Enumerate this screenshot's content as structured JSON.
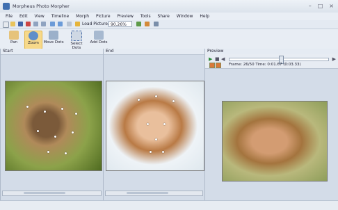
{
  "window": {
    "title": "Morpheus Photo Morpher",
    "controls": [
      "–",
      "□",
      "×"
    ]
  },
  "menu": [
    "File",
    "Edit",
    "View",
    "Timeline",
    "Morph",
    "Picture",
    "Preview",
    "Tools",
    "Share",
    "Window",
    "Help"
  ],
  "toolbar1": {
    "load_label": "Load Picture...",
    "zoom_value": "90.26%"
  },
  "tools": [
    {
      "label": "Pan",
      "icon": "hand-icon"
    },
    {
      "label": "Zoom",
      "icon": "magnifier-icon",
      "active": true
    },
    {
      "label": "Move Dots",
      "icon": "move-dots-icon"
    },
    {
      "label": "Select Dots",
      "icon": "select-dots-icon"
    },
    {
      "label": "Add Dots",
      "icon": "add-dots-icon"
    }
  ],
  "panels": {
    "start": {
      "title": "Start"
    },
    "end": {
      "title": "End"
    },
    "preview": {
      "title": "Preview",
      "frame_info": "Frame: 26/50 Time: 0:01.67 (0:03.33)",
      "progress": 0.52
    }
  },
  "colors": {
    "accent": "#3f6fb0",
    "active_tool": "#f7d98a"
  }
}
